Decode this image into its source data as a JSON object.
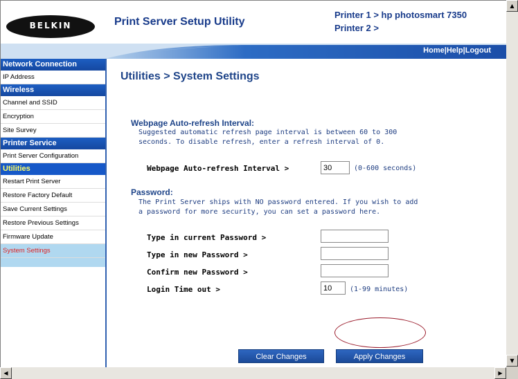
{
  "header": {
    "logo_text": "BELKIN",
    "app_title": "Print Server Setup Utility",
    "printer1": "Printer 1 > hp photosmart 7350",
    "printer2": "Printer 2 >"
  },
  "topnav": {
    "home": "Home",
    "sep1": "|",
    "help": "Help",
    "sep2": "|",
    "logout": "Logout"
  },
  "sidebar": {
    "network_head": "Network Connection",
    "ip_address": "IP Address",
    "wireless_head": "Wireless",
    "channel_ssid": "Channel and SSID",
    "encryption": "Encryption",
    "site_survey": "Site Survey",
    "printer_head": "Printer Service",
    "print_server_config": "Print Server Configuration",
    "utilities_head": "Utilities",
    "restart": "Restart Print Server",
    "restore_factory": "Restore Factory Default",
    "save_current": "Save Current Settings",
    "restore_previous": "Restore Previous Settings",
    "firmware": "Firmware Update",
    "system_settings": "System Settings"
  },
  "main": {
    "title": "Utilities > System Settings",
    "refresh_heading": "Webpage Auto-refresh Interval:",
    "refresh_desc_1": "Suggested automatic refresh page interval is between 60 to 300",
    "refresh_desc_2": "seconds. To disable refresh, enter a refresh interval of 0.",
    "refresh_label": "Webpage Auto-refresh Interval >",
    "refresh_value": "30",
    "refresh_hint": "(0-600 seconds)",
    "password_heading": "Password:",
    "password_desc_1": "The Print Server ships with NO password entered. If you wish to add",
    "password_desc_2": "a password for more security, you can set a password here.",
    "current_pw_label": "Type in current Password >",
    "current_pw_value": "",
    "new_pw_label": "Type in new Password >",
    "new_pw_value": "",
    "confirm_pw_label": "Confirm new Password >",
    "confirm_pw_value": "",
    "timeout_label": "Login Time out >",
    "timeout_value": "10",
    "timeout_hint": "(1-99 minutes)",
    "clear_btn": "Clear Changes",
    "apply_btn": "Apply Changes"
  },
  "colors": {
    "brand_blue": "#1d4388",
    "active_item_bg": "#b0d8f0",
    "active_item_text": "#e02020",
    "annotation": "#9a1a2a"
  }
}
